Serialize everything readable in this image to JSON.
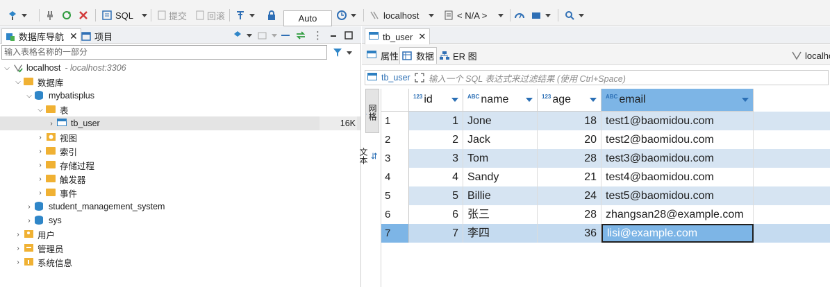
{
  "toolbar": {
    "sql_label": "SQL",
    "commit_label": "提交",
    "rollback_label": "回滚",
    "auto_label": "Auto",
    "connection_label": "localhost",
    "schema_label": "< N/A >"
  },
  "left": {
    "tab_navigator": "数据库导航",
    "tab_project": "项目",
    "filter_placeholder": "输入表格名称的一部分",
    "tree": [
      {
        "label": "localhost",
        "sub": " - localhost:3306"
      },
      {
        "label": "数据库"
      },
      {
        "label": "mybatisplus"
      },
      {
        "label": "表"
      },
      {
        "label": "tb_user",
        "size": "16K"
      },
      {
        "label": "视图"
      },
      {
        "label": "索引"
      },
      {
        "label": "存储过程"
      },
      {
        "label": "触发器"
      },
      {
        "label": "事件"
      },
      {
        "label": "student_management_system"
      },
      {
        "label": "sys"
      },
      {
        "label": "用户"
      },
      {
        "label": "管理员"
      },
      {
        "label": "系统信息"
      }
    ]
  },
  "right": {
    "editor_tab": "tb_user",
    "subtab_properties": "属性",
    "subtab_data": "数据",
    "subtab_er": "ER 图",
    "connection_short": "localho",
    "filter_table": "tb_user",
    "filter_placeholder": "输入一个 SQL 表达式来过滤结果 (使用 Ctrl+Space)",
    "vtab_grid": "网格",
    "vtab_text": "文本"
  },
  "grid": {
    "columns": [
      {
        "type": "123",
        "name": "id"
      },
      {
        "type": "ABC",
        "name": "name"
      },
      {
        "type": "123",
        "name": "age"
      },
      {
        "type": "ABC",
        "name": "email"
      }
    ],
    "rows": [
      {
        "n": "1",
        "id": "1",
        "name": "Jone",
        "age": "18",
        "email": "test1@baomidou.com"
      },
      {
        "n": "2",
        "id": "2",
        "name": "Jack",
        "age": "20",
        "email": "test2@baomidou.com"
      },
      {
        "n": "3",
        "id": "3",
        "name": "Tom",
        "age": "28",
        "email": "test3@baomidou.com"
      },
      {
        "n": "4",
        "id": "4",
        "name": "Sandy",
        "age": "21",
        "email": "test4@baomidou.com"
      },
      {
        "n": "5",
        "id": "5",
        "name": "Billie",
        "age": "24",
        "email": "test5@baomidou.com"
      },
      {
        "n": "6",
        "id": "6",
        "name": "张三",
        "age": "28",
        "email": "zhangsan28@example.com"
      },
      {
        "n": "7",
        "id": "7",
        "name": "李四",
        "age": "36",
        "email": "lisi@example.com"
      }
    ]
  },
  "colors": {
    "accent": "#2b6fb5",
    "selection": "#7db5e6",
    "row_stripe": "#d6e4f2"
  }
}
